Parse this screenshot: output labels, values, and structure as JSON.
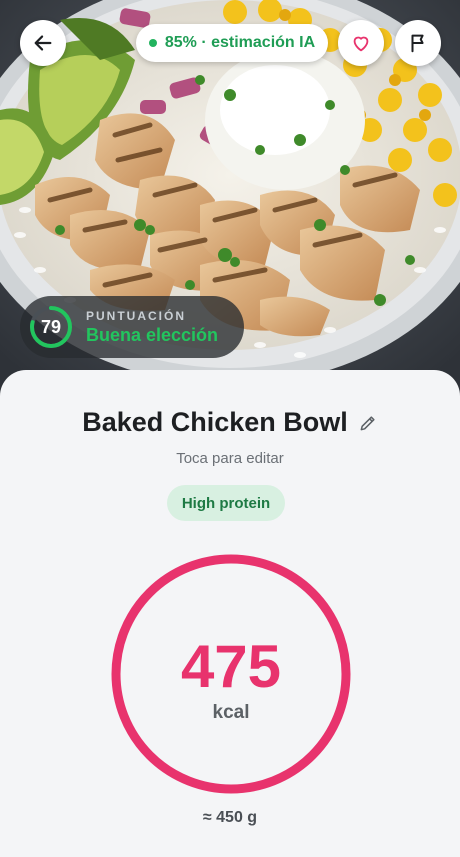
{
  "header": {
    "confidence_badge": "85% · estimación IA",
    "accent_green": "#22b35e",
    "favorite_color": "#e8336d"
  },
  "icons": {
    "back": "arrow-left-icon",
    "favorite": "heart-outline-icon",
    "report": "flag-icon",
    "edit": "pencil-icon"
  },
  "score": {
    "label": "PUNTUACIÓN",
    "value": "79",
    "fraction": 0.79,
    "verdict": "Buena elección",
    "color": "#22c55e"
  },
  "meal": {
    "title": "Baked Chicken Bowl",
    "edit_hint": "Toca para editar",
    "tag": "High protein",
    "calories": "475",
    "calories_unit": "kcal",
    "weight": "≈ 450 g",
    "ring_color": "#e8336d"
  }
}
